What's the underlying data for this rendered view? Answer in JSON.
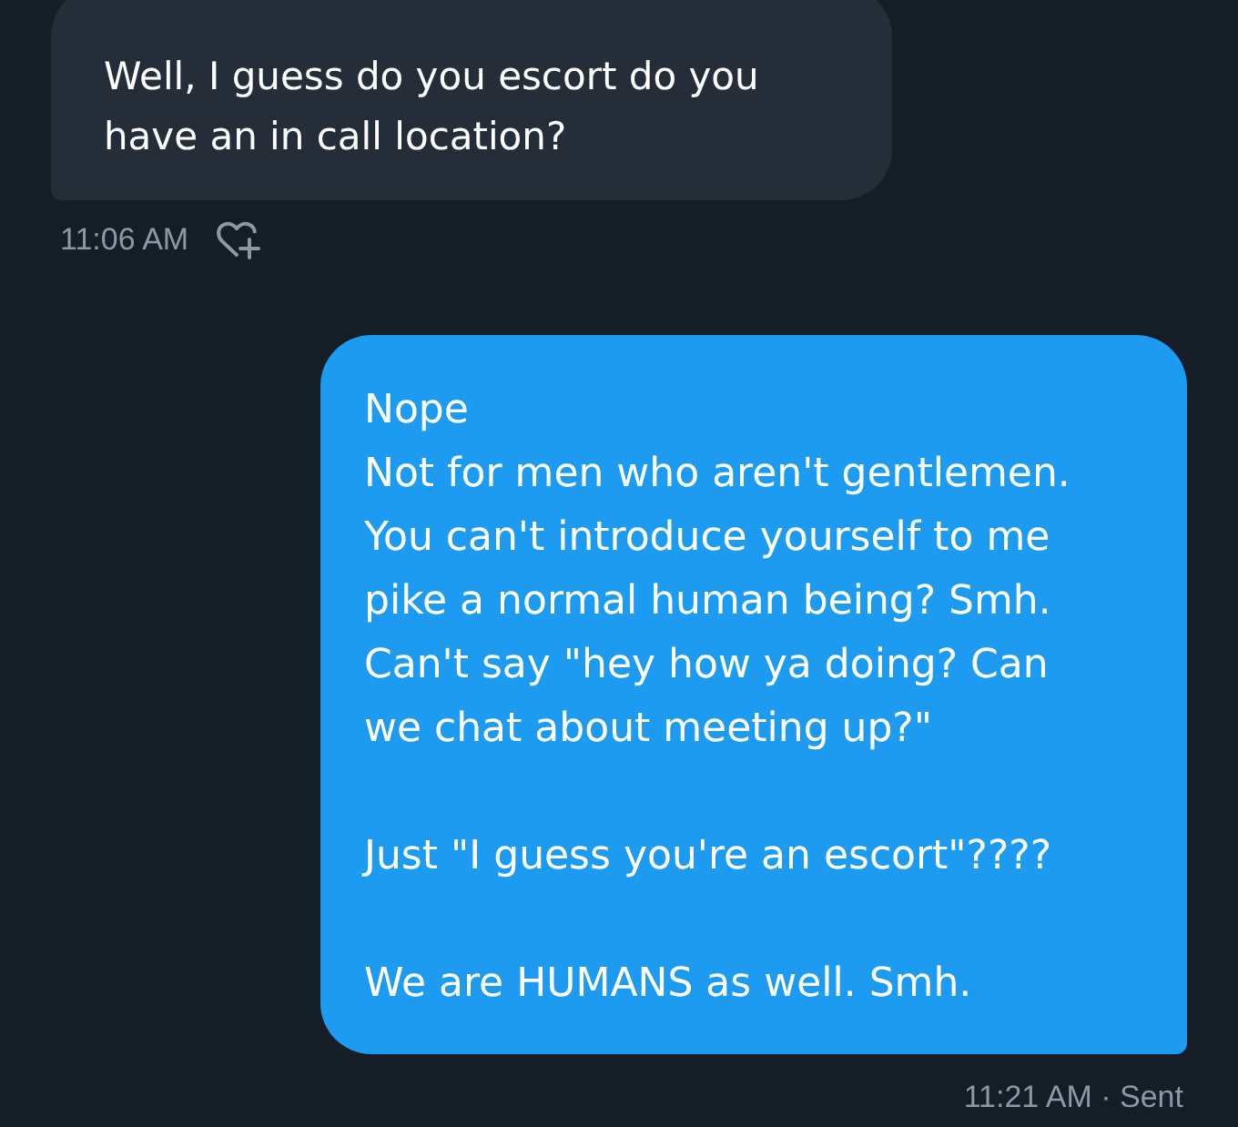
{
  "messages": [
    {
      "kind": "received",
      "text": "Well, I guess do you escort do you\nhave an in call location?",
      "time": "11:06 AM"
    },
    {
      "kind": "sent",
      "text": "Nope\nNot for men who aren't gentlemen.\nYou can't introduce yourself to me\npike a normal human being? Smh.\nCan't say \"hey how ya doing? Can\nwe chat about meeting up?\"\n\nJust \"I guess you're an escort\"????\n\nWe are HUMANS as well. Smh.",
      "time": "11:21 AM · Sent"
    }
  ]
}
